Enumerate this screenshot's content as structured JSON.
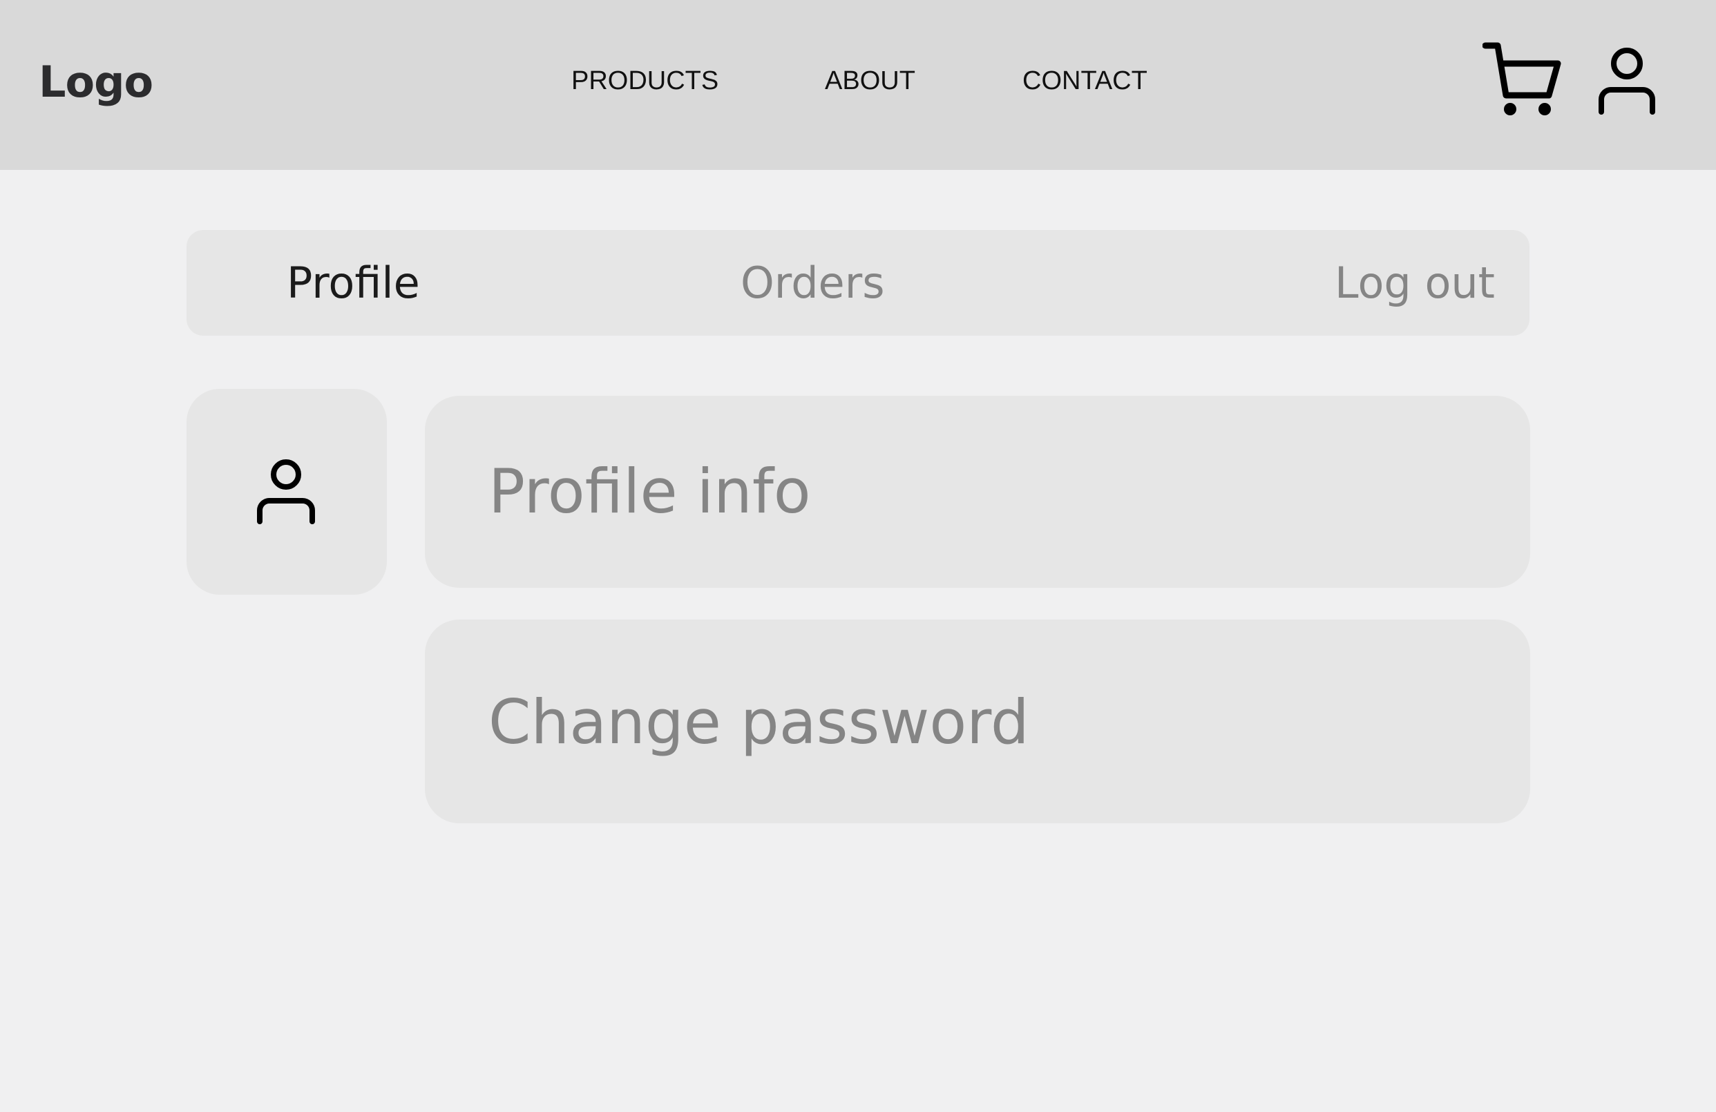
{
  "header": {
    "logo": "Logo",
    "nav": {
      "products": "PRODUCTS",
      "about": "ABOUT",
      "contact": "CONTACT"
    },
    "icons": {
      "cart": "cart-icon",
      "user": "user-icon"
    }
  },
  "tabs": {
    "profile": "Profile",
    "orders": "Orders",
    "logout": "Log out",
    "active": "Profile"
  },
  "avatar": {
    "icon": "user-icon"
  },
  "options": {
    "profile_info": "Profile info",
    "change_password": "Change password"
  },
  "colors": {
    "header_bg": "#d9d9d9",
    "page_bg": "#f0f0f1",
    "card_bg": "#e6e6e6",
    "active_text": "#1b1b1b",
    "inactive_text": "#858585"
  }
}
